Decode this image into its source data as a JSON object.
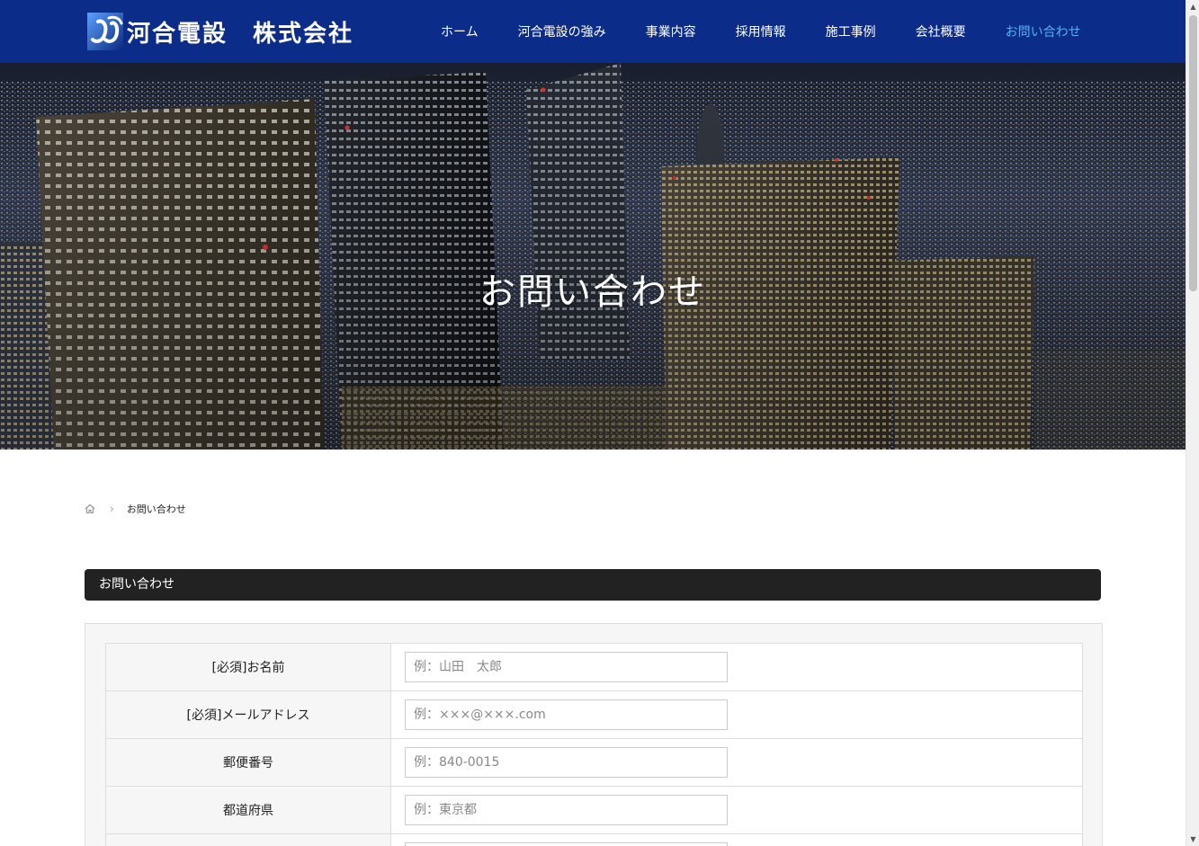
{
  "header": {
    "logo_text": "河合電設　株式会社",
    "nav": [
      {
        "label": "ホーム",
        "active": false
      },
      {
        "label": "河合電設の強み",
        "active": false
      },
      {
        "label": "事業内容",
        "active": false
      },
      {
        "label": "採用情報",
        "active": false
      },
      {
        "label": "施工事例",
        "active": false
      },
      {
        "label": "会社概要",
        "active": false
      },
      {
        "label": "お問い合わせ",
        "active": true
      }
    ]
  },
  "hero": {
    "title": "お問い合わせ"
  },
  "breadcrumb": {
    "home_icon": "home-icon",
    "separator": "›",
    "current": "お問い合わせ"
  },
  "section": {
    "title": "お問い合わせ"
  },
  "form": {
    "rows": [
      {
        "label": "[必須]お名前",
        "placeholder": "例：山田　太郎",
        "value": ""
      },
      {
        "label": "[必須]メールアドレス",
        "placeholder": "例：×××@×××.com",
        "value": ""
      },
      {
        "label": "郵便番号",
        "placeholder": "例：840-0015",
        "value": ""
      },
      {
        "label": "都道府県",
        "placeholder": "例：東京都",
        "value": ""
      },
      {
        "label": "",
        "placeholder": "",
        "value": ""
      }
    ]
  },
  "colors": {
    "header_bg": "#0c2c8a",
    "nav_active": "#4fb3f0",
    "section_bar": "#222222"
  }
}
